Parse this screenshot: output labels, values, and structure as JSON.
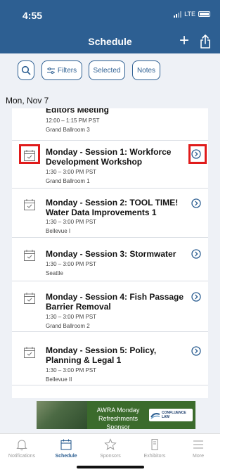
{
  "status_bar": {
    "time": "4:55",
    "network": "LTE"
  },
  "nav": {
    "title": "Schedule",
    "add_icon": "plus-icon",
    "share_icon": "share-icon"
  },
  "filters": {
    "search_icon": "search-icon",
    "filters_label": "Filters",
    "selected_label": "Selected",
    "notes_label": "Notes"
  },
  "date_header": "Mon, Nov 7",
  "sessions": [
    {
      "title": "Editors Meeting",
      "time": "12:00 – 1:15 PM PST",
      "room": "Grand Ballroom 3"
    },
    {
      "title": "Monday - Session 1: Workforce Development Workshop",
      "time": "1:30 – 3:00 PM PST",
      "room": "Grand Ballroom 1"
    },
    {
      "title": "Monday - Session 2: TOOL TIME! Water Data Improvements 1",
      "time": "1:30 – 3:00 PM PST",
      "room": "Bellevue I"
    },
    {
      "title": "Monday - Session 3: Stormwater",
      "time": "1:30 – 3:00 PM PST",
      "room": "Seattle"
    },
    {
      "title": "Monday - Session 4: Fish Passage Barrier Removal",
      "time": "1:30 – 3:00 PM PST",
      "room": "Grand Ballroom 2"
    },
    {
      "title": "Monday - Session 5: Policy, Planning & Legal 1",
      "time": "1:30 – 3:00 PM PST",
      "room": "Bellevue II"
    }
  ],
  "ad": {
    "line1": "AWRA Monday",
    "line2": "Refreshments Sponsor",
    "logo_line1": "CONFLUENCE",
    "logo_line2": "LAW"
  },
  "tabs": [
    {
      "label": "Notifications",
      "icon": "bell-icon",
      "active": false
    },
    {
      "label": "Schedule",
      "icon": "calendar-icon",
      "active": true
    },
    {
      "label": "Sponsors",
      "icon": "star-icon",
      "active": false
    },
    {
      "label": "Exhibitors",
      "icon": "booth-icon",
      "active": false
    },
    {
      "label": "More",
      "icon": "menu-icon",
      "active": false
    }
  ],
  "colors": {
    "brand": "#2d5f92",
    "highlight": "#e01b1b",
    "background": "#eef1f6"
  }
}
